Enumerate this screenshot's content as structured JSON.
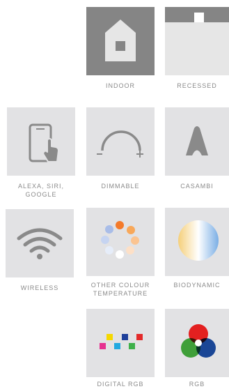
{
  "features": [
    {
      "id": "indoor",
      "label": "INDOOR",
      "icon": "house-icon"
    },
    {
      "id": "recessed",
      "label": "RECESSED",
      "icon": "recessed-light-icon"
    },
    {
      "id": "alexa",
      "label": "ALEXA, SIRI,\nGOOGLE",
      "icon": "tablet-touch-icon"
    },
    {
      "id": "dimmable",
      "label": "DIMMABLE",
      "icon": "dimmer-arc-icon"
    },
    {
      "id": "casambi",
      "label": "CASAMBI",
      "icon": "casambi-logo-icon"
    },
    {
      "id": "wireless",
      "label": "WIRELESS",
      "icon": "wifi-icon"
    },
    {
      "id": "colour_temp",
      "label": "OTHER COLOUR\nTEMPERATURE",
      "icon": "colour-temperature-dots-icon"
    },
    {
      "id": "biodynamic",
      "label": "BIODYNAMIC",
      "icon": "biodynamic-gradient-icon"
    },
    {
      "id": "digital_rgb",
      "label": "DIGITAL RGB",
      "icon": "digital-rgb-squares-icon"
    },
    {
      "id": "rgb",
      "label": "RGB",
      "icon": "rgb-circles-icon"
    }
  ],
  "colors": {
    "tile_bg": "#e2e2e4",
    "tile_dark_bg": "#858585",
    "icon_gray": "#8a8a8a",
    "label_gray": "#8a8a8a"
  }
}
